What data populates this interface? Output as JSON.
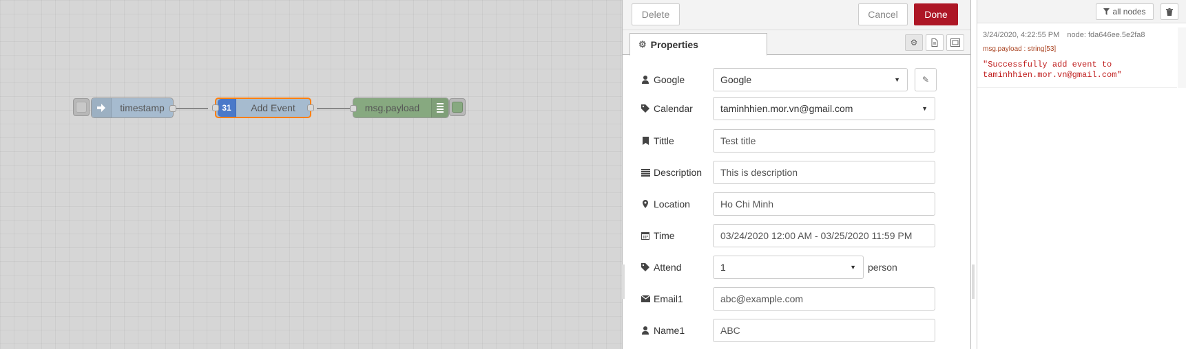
{
  "workspace": {
    "nodes": [
      {
        "label": "timestamp",
        "icon": "arrow-in-icon",
        "color": "#a6bbcf"
      },
      {
        "label": "Add Event",
        "icon": "google-calendar-icon",
        "icon_text": "31",
        "color": "#a6bbcf",
        "selected": true
      },
      {
        "label": "msg.payload",
        "icon": "list-icon",
        "color": "#87a980"
      }
    ]
  },
  "tray": {
    "delete_label": "Delete",
    "cancel_label": "Cancel",
    "done_label": "Done",
    "tab_label": "Properties",
    "fields": {
      "google": {
        "label": "Google",
        "value": "Google",
        "icon": "user-icon"
      },
      "calendar": {
        "label": "Calendar",
        "value": "taminhhien.mor.vn@gmail.com",
        "icon": "tag-icon"
      },
      "title": {
        "label": "Tittle",
        "value": "Test title",
        "icon": "bookmark-icon"
      },
      "description": {
        "label": "Description",
        "value": "This is description",
        "icon": "lines-icon"
      },
      "location": {
        "label": "Location",
        "value": "Ho Chi Minh",
        "icon": "map-marker-icon"
      },
      "time": {
        "label": "Time",
        "value": "03/24/2020 12:00 AM - 03/25/2020 11:59 PM",
        "icon": "calendar-icon"
      },
      "attend": {
        "label": "Attend",
        "value": "1",
        "suffix": "person",
        "icon": "tag-icon"
      },
      "email1": {
        "label": "Email1",
        "value": "abc@example.com",
        "icon": "envelope-icon"
      },
      "name1": {
        "label": "Name1",
        "value": "ABC",
        "icon": "user-icon"
      }
    },
    "accent": "#ad1625"
  },
  "sidebar": {
    "filter_label": "all nodes",
    "message": {
      "timestamp": "3/24/2020, 4:22:55 PM",
      "node": "node: fda646ee.5e2fa8",
      "type": "msg.payload : string[53]",
      "value": "\"Successfully add event to taminhhien.mor.vn@gmail.com\""
    }
  }
}
